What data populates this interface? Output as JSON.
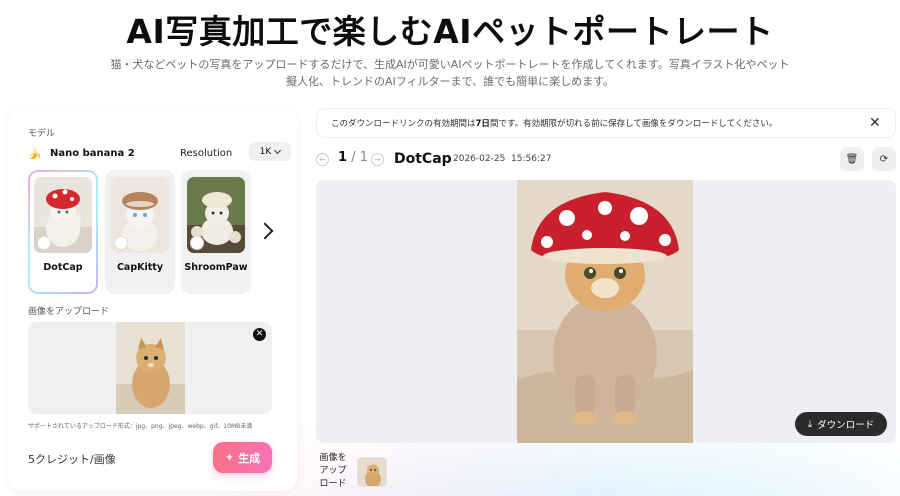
{
  "hero": {
    "title": "AI写真加工で楽しむAIペットポートレート",
    "subtitle": "猫・犬などペットの写真をアップロードするだけで、生成AIが可愛いAIペットポートレートを作成してくれます。写真イラスト化やペット擬人化、トレンドのAIフィルターまで、誰でも簡単に楽しめます。"
  },
  "left_panel": {
    "model_label": "モデル",
    "model_icon": "banana-icon",
    "model_name": "Nano banana 2",
    "resolution_label": "Resolution",
    "resolution_value": "1K",
    "styles": [
      {
        "label": "DotCap",
        "selected": true
      },
      {
        "label": "CapKitty",
        "selected": false
      },
      {
        "label": "ShroomPaw",
        "selected": false
      }
    ],
    "upload_label": "画像をアップロード",
    "supported_formats": "サポートされているアップロード形式：jpg、png、jpeg、webp、gif。10MB未満",
    "credits": "5クレジット/画像",
    "generate_button": "生成"
  },
  "notice": {
    "text_before": "このダウンロードリンクの有効期間は",
    "text_bold": "7日",
    "text_after": "間です。有効期限が切れる前に保存して画像をダウンロードしてください。"
  },
  "result": {
    "page_current": "1",
    "page_separator": "/",
    "page_total": "1",
    "title": "DotCap",
    "date": "2026-02-25",
    "time": "15:56:27",
    "download_button": "ダウンロード",
    "history_label": "画像をアップロード"
  }
}
